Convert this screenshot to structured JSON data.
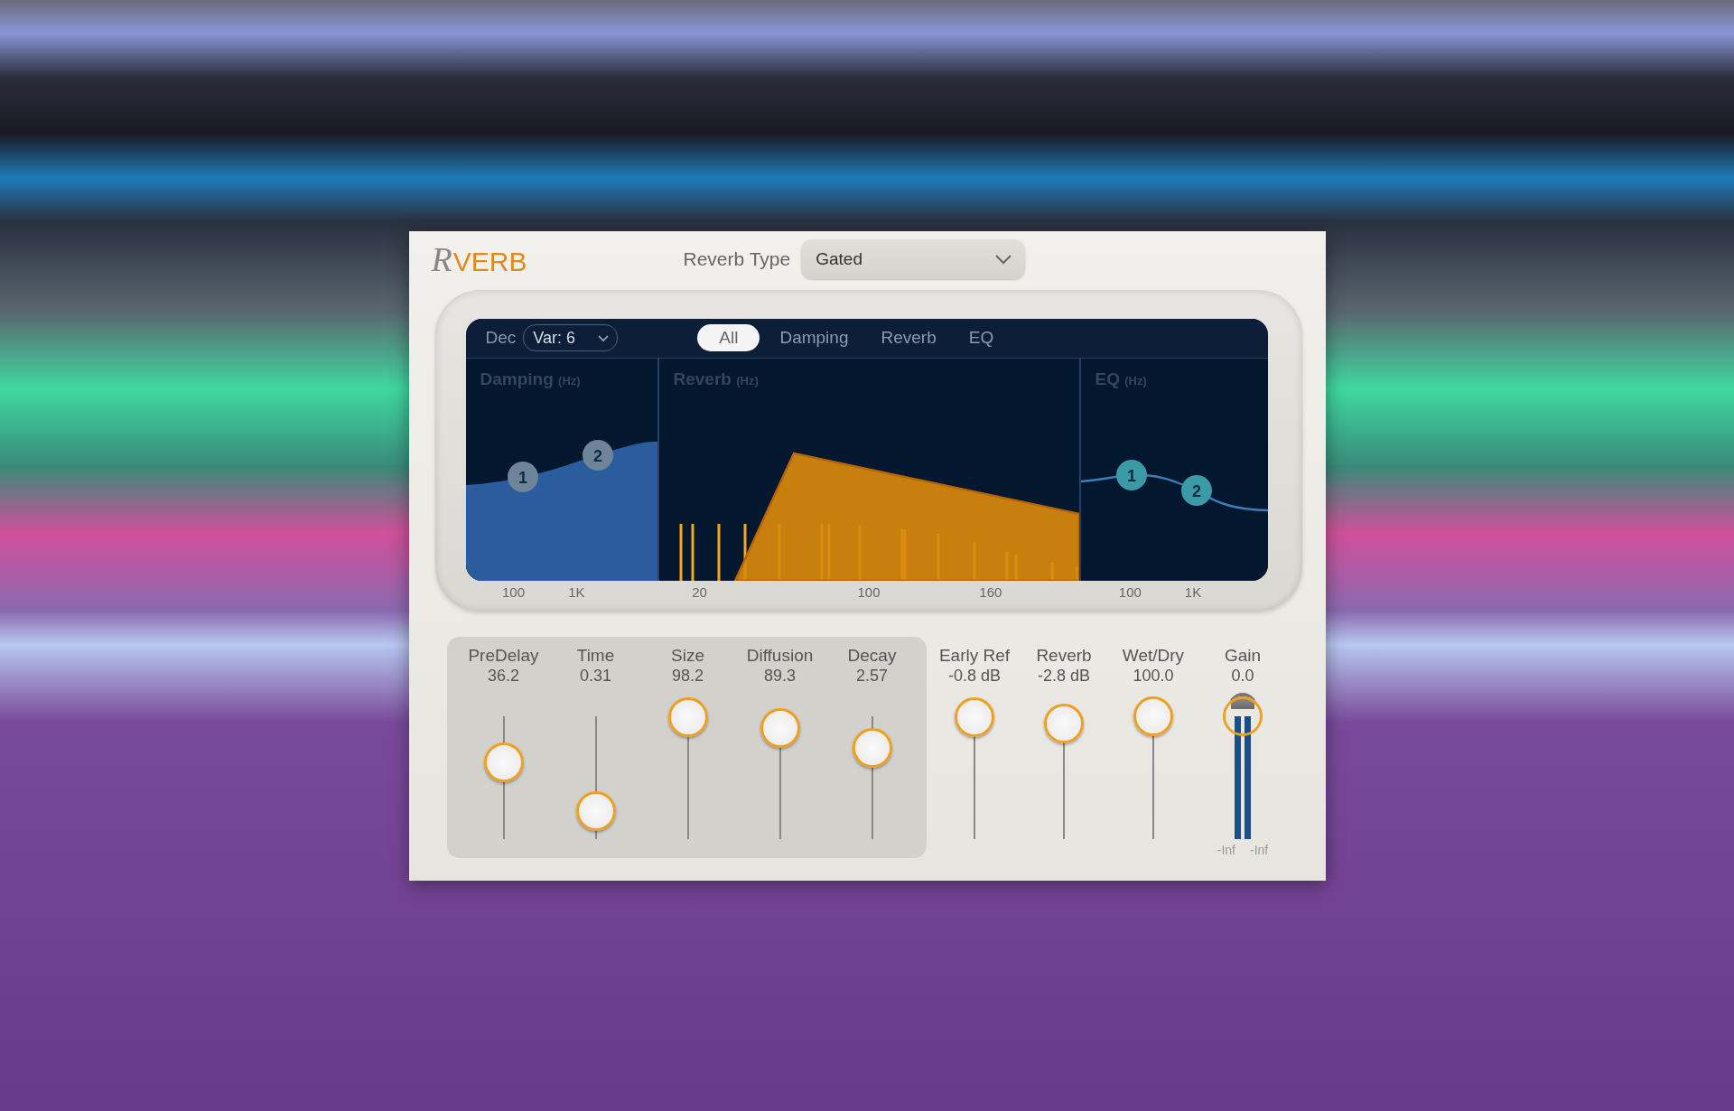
{
  "plugin": {
    "logo": {
      "initial": "R",
      "text": "VERB"
    },
    "reverb_type": {
      "label": "Reverb Type",
      "value": "Gated"
    }
  },
  "display": {
    "dec_label": "Dec",
    "variation": "Var: 6",
    "tabs": [
      {
        "label": "All",
        "selected": true
      },
      {
        "label": "Damping",
        "selected": false
      },
      {
        "label": "Reverb",
        "selected": false
      },
      {
        "label": "EQ",
        "selected": false
      }
    ],
    "panels": [
      {
        "kind": "damping",
        "title": "Damping",
        "unit": "(Hz)",
        "ticks": [
          "100",
          "1K"
        ],
        "nodes": [
          "1",
          "2"
        ]
      },
      {
        "kind": "reverb",
        "title": "Reverb",
        "unit": "(Hz)",
        "ticks": [
          "20",
          "100",
          "160"
        ]
      },
      {
        "kind": "eq",
        "title": "EQ",
        "unit": "(Hz)",
        "ticks": [
          "100",
          "1K"
        ],
        "nodes": [
          "1",
          "2"
        ]
      }
    ]
  },
  "slider_groups": [
    {
      "kind": "panel",
      "sliders": [
        {
          "kind": "slider",
          "label": "PreDelay",
          "reading": "36.2",
          "level": 0.62
        },
        {
          "kind": "slider",
          "label": "Time",
          "reading": "0.31",
          "level": 0.22
        },
        {
          "kind": "slider",
          "label": "Size",
          "reading": "98.2",
          "level": 0.99
        },
        {
          "kind": "slider",
          "label": "Diffusion",
          "reading": "89.3",
          "level": 0.9
        },
        {
          "kind": "slider",
          "label": "Decay",
          "reading": "2.57",
          "level": 0.74
        }
      ]
    },
    {
      "kind": "plain",
      "sliders": [
        {
          "kind": "slider",
          "label": "Early Ref",
          "reading": "-0.8 dB",
          "level": 0.99
        },
        {
          "kind": "slider",
          "label": "Reverb",
          "reading": "-2.8 dB",
          "level": 0.94
        },
        {
          "kind": "slider",
          "label": "Wet/Dry",
          "reading": "100.0",
          "level": 1.0
        },
        {
          "kind": "fader",
          "label": "Gain",
          "reading": "0.0",
          "level": 1.0,
          "meter_readings": [
            "-Inf",
            "-Inf"
          ]
        }
      ]
    }
  ]
}
